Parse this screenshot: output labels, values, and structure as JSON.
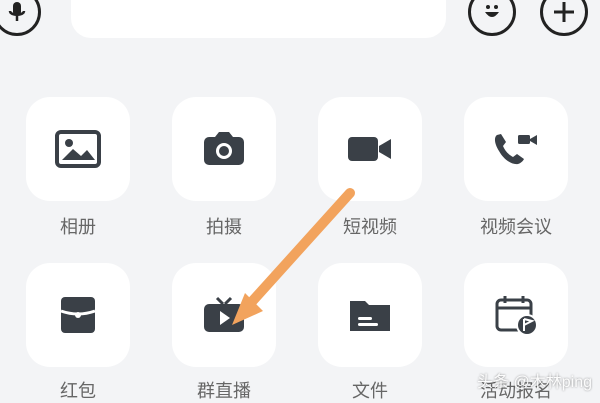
{
  "composer": {
    "placeholder": ""
  },
  "actions": [
    {
      "key": "album",
      "label": "相册",
      "icon": "image-icon"
    },
    {
      "key": "photo",
      "label": "拍摄",
      "icon": "camera-icon"
    },
    {
      "key": "short_video",
      "label": "短视频",
      "icon": "video-camera-icon"
    },
    {
      "key": "video_meeting",
      "label": "视频会议",
      "icon": "video-call-icon"
    },
    {
      "key": "red_packet",
      "label": "红包",
      "icon": "red-packet-icon"
    },
    {
      "key": "group_live",
      "label": "群直播",
      "icon": "tv-play-icon"
    },
    {
      "key": "file",
      "label": "文件",
      "icon": "folder-icon"
    },
    {
      "key": "event_signup",
      "label": "活动报名",
      "icon": "calendar-flag-icon"
    }
  ],
  "watermark": {
    "text": "头条 @木林ping"
  },
  "colors": {
    "background": "#f3f4f6",
    "tile": "#ffffff",
    "icon": "#3a4047",
    "arrow": "#f2a35d"
  }
}
